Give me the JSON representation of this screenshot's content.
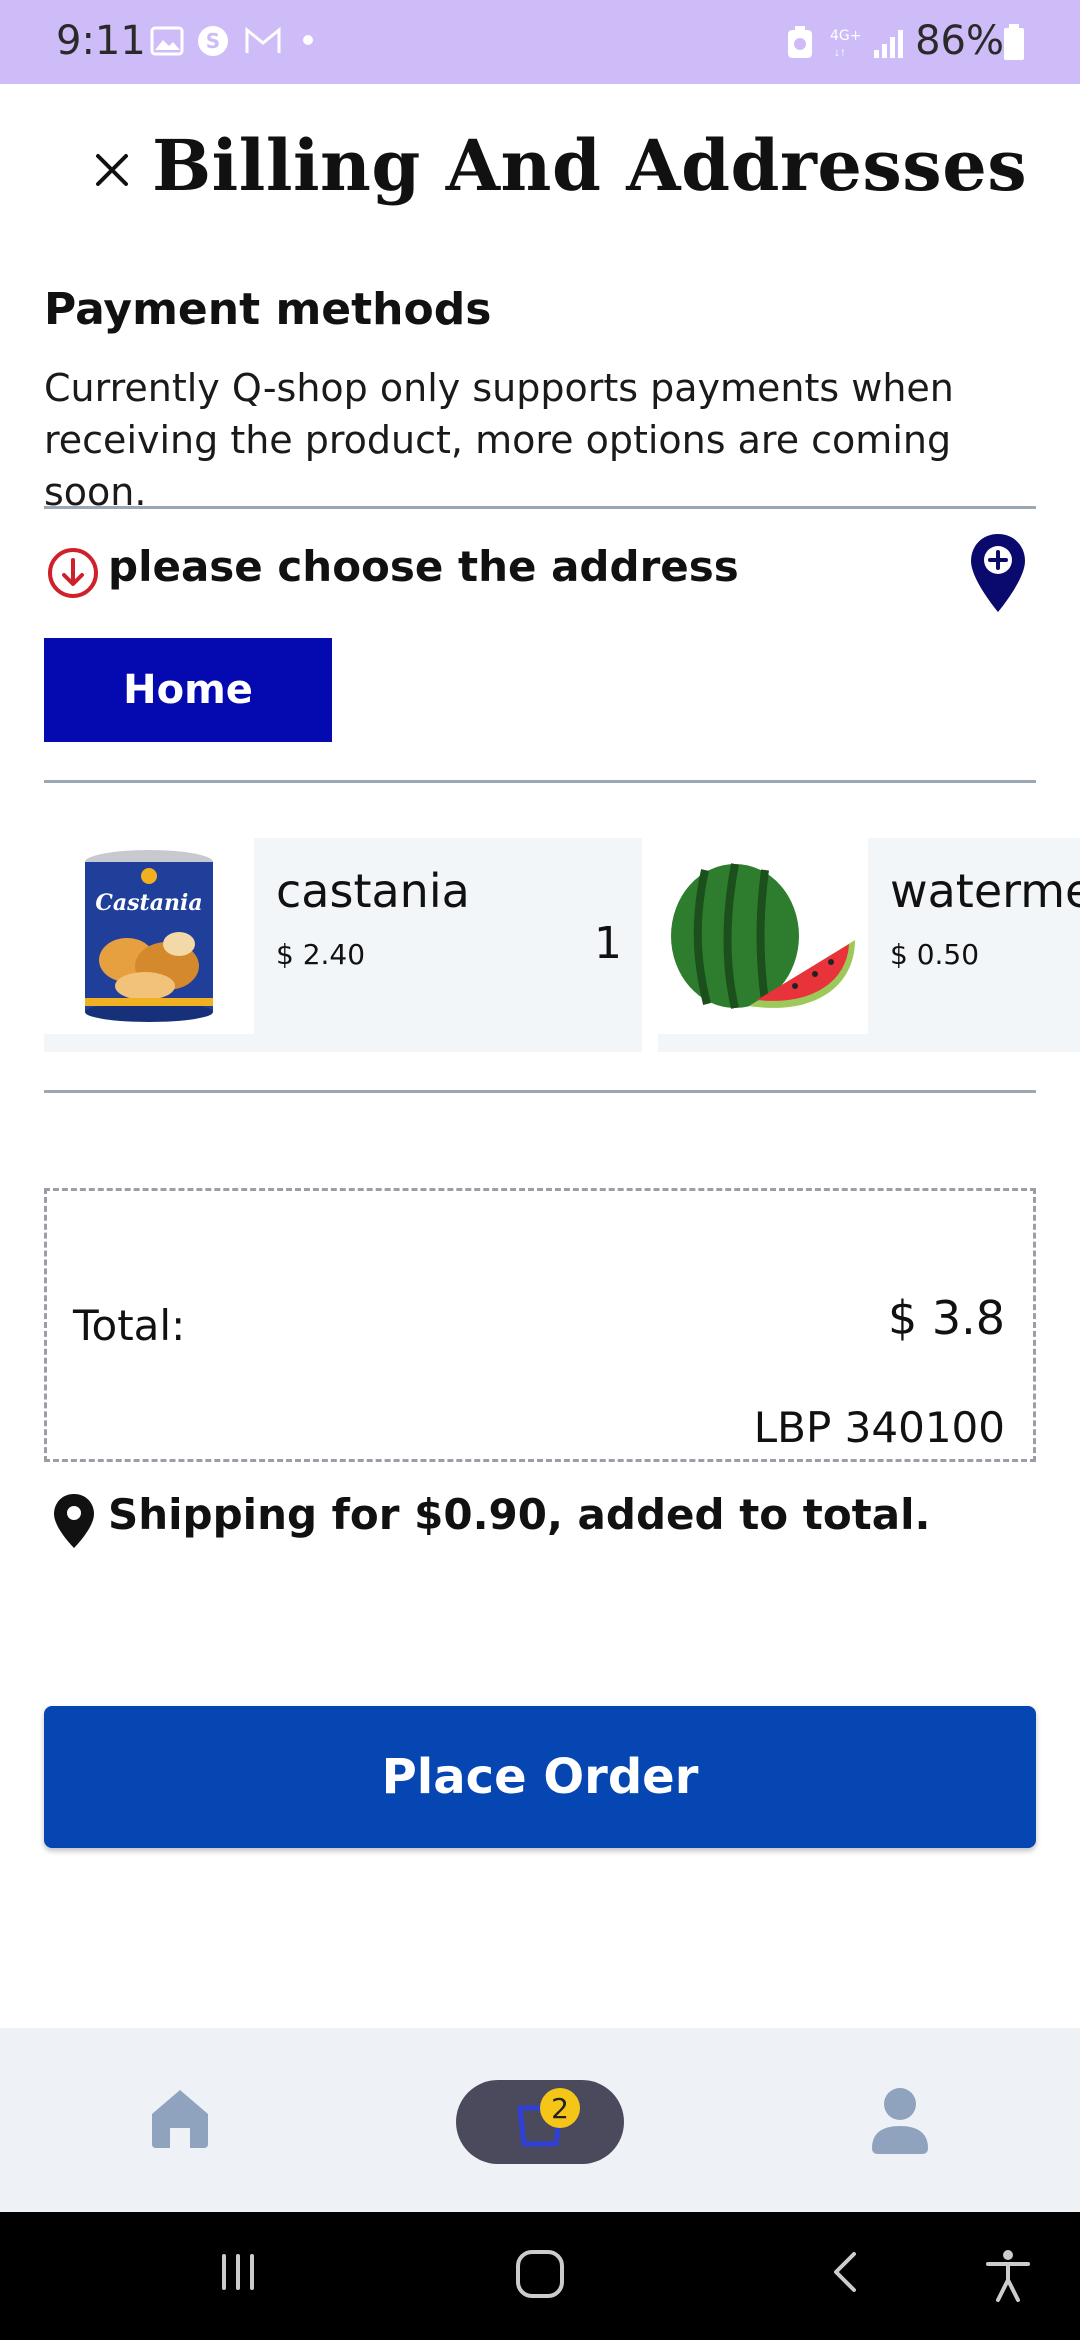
{
  "status_bar": {
    "time": "9:11",
    "battery": "86%",
    "network": "4G+",
    "background_color": "#cdbcf7"
  },
  "header": {
    "title": "Billing And Addresses",
    "close_icon": "close-icon"
  },
  "payment": {
    "title": "Payment methods",
    "description": "Currently Q-shop only supports payments when receiving the product, more options are coming soon."
  },
  "address": {
    "prompt": "please choose the address",
    "selected": "Home",
    "chip_color": "#0509b0"
  },
  "cart": {
    "items": [
      {
        "name": "castania",
        "price": "$ 2.40",
        "quantity": "1"
      },
      {
        "name": "watermelon",
        "price": "$ 0.50",
        "quantity": ""
      }
    ]
  },
  "totals": {
    "label": "Total:",
    "usd": "$ 3.8",
    "lbp": "LBP 340100"
  },
  "shipping": {
    "note": "Shipping for $0.90, added to total."
  },
  "actions": {
    "place_order": "Place Order",
    "button_color": "#0546b3"
  },
  "bottom_nav": {
    "items": [
      "home-icon",
      "cart-icon",
      "profile-icon"
    ],
    "cart_badge": "2",
    "badge_color": "#f5c518"
  }
}
